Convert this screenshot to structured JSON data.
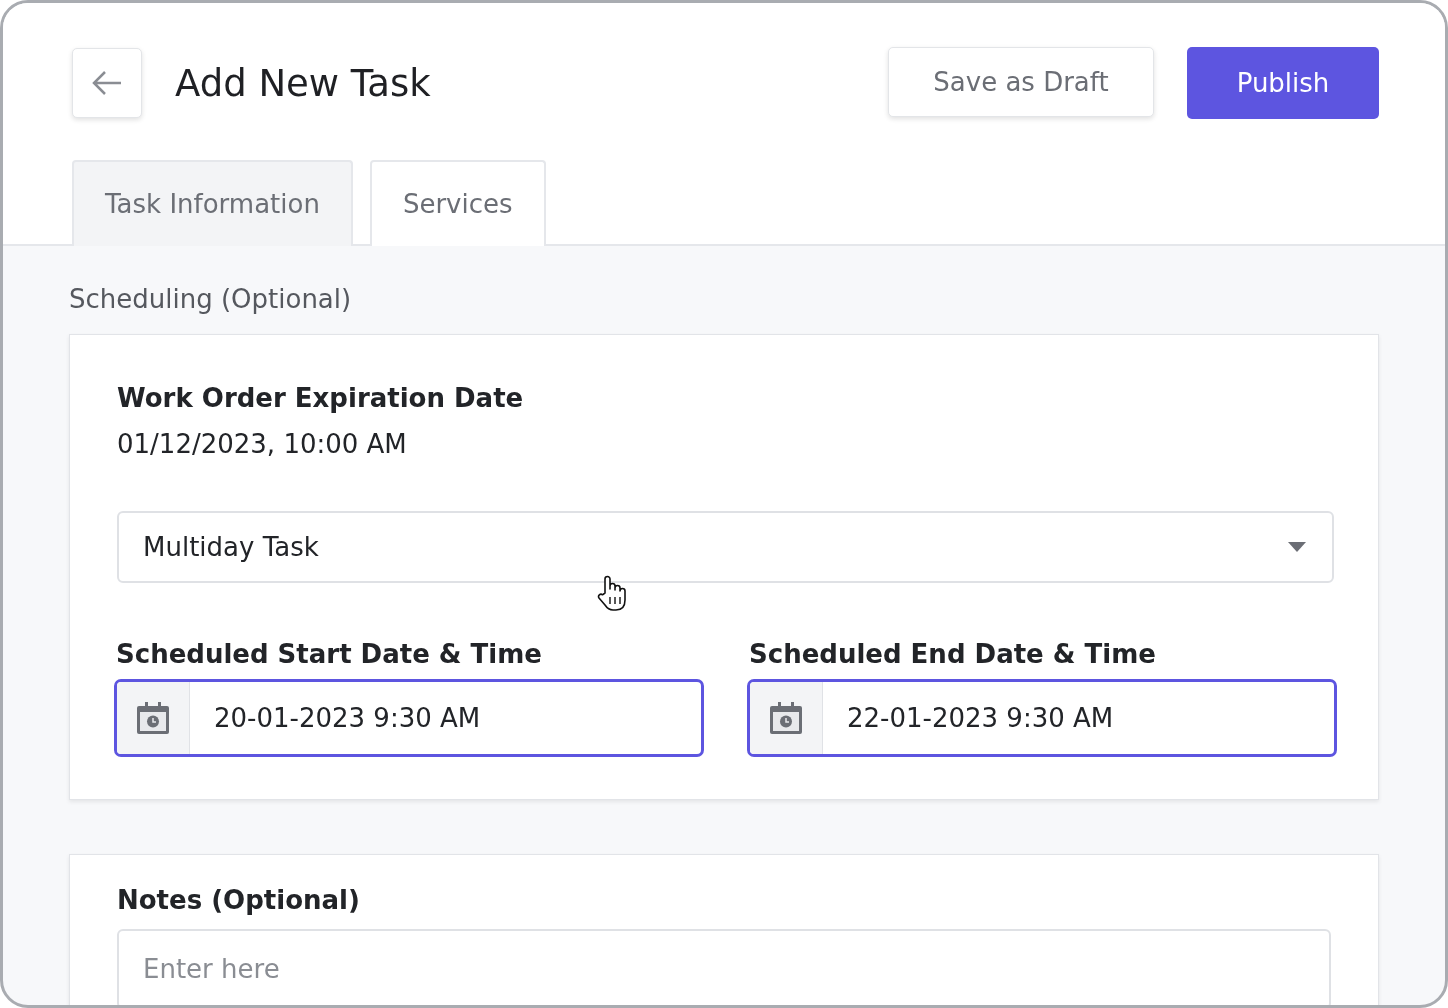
{
  "header": {
    "title": "Add New Task",
    "buttons": [
      {
        "label": "Save as Draft",
        "kind": "secondary"
      },
      {
        "label": "Publish",
        "kind": "primary"
      }
    ]
  },
  "tabs": [
    {
      "label": "Task Information",
      "selected": true
    },
    {
      "label": "Services",
      "selected": false
    }
  ],
  "scheduling": {
    "heading": "Scheduling (Optional)",
    "expiration_label": "Work Order Expiration Date",
    "expiration_value": "01/12/2023, 10:00 AM",
    "task_type": {
      "value": "Multiday Task"
    },
    "fields": [
      {
        "label": "Scheduled Start Date & Time",
        "value": "20-01-2023 9:30 AM",
        "focused": true
      },
      {
        "label": "Scheduled End Date & Time",
        "value": "22-01-2023 9:30 AM",
        "focused": true
      }
    ]
  },
  "notes": {
    "label": "Notes (Optional)",
    "placeholder": "Enter here"
  }
}
